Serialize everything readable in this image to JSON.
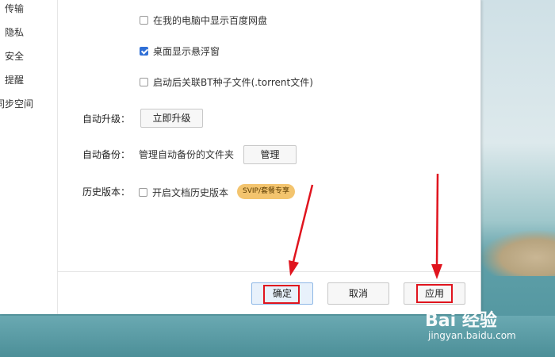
{
  "sidebar": {
    "items": [
      {
        "label": "传输"
      },
      {
        "label": "隐私"
      },
      {
        "label": "安全"
      },
      {
        "label": "提醒"
      },
      {
        "label": "同步空间"
      }
    ]
  },
  "options": {
    "show_in_my_computer": {
      "label": "在我的电脑中显示百度网盘",
      "checked": false
    },
    "desktop_float": {
      "label": "桌面显示悬浮窗",
      "checked": true
    },
    "associate_bt": {
      "label": "启动后关联BT种子文件(.torrent文件)",
      "checked": false
    }
  },
  "auto_upgrade": {
    "label": "自动升级：",
    "button": "立即升级"
  },
  "auto_backup": {
    "label": "自动备份：",
    "description": "管理自动备份的文件夹",
    "button": "管理"
  },
  "history_version": {
    "label": "历史版本：",
    "checkbox_label": "开启文档历史版本",
    "checked": false,
    "badge": "SVIP/套餐专享"
  },
  "footer": {
    "ok": "确定",
    "cancel": "取消",
    "apply": "应用"
  },
  "watermark": {
    "logo": "Bai 经验",
    "url": "jingyan.baidu.com"
  },
  "colors": {
    "highlight": "#e0141e",
    "checkbox_checked": "#2f6fd6",
    "badge_bg": "#f3c46e"
  }
}
